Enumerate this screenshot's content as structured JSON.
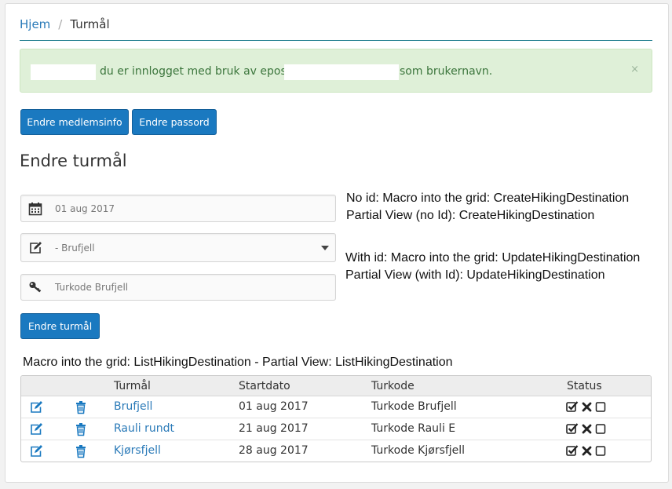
{
  "breadcrumb": {
    "home": "Hjem",
    "separator": "/",
    "current": "Turmål"
  },
  "alert": {
    "text_before": "du er innlogget med bruk av epost",
    "text_after": "som brukernavn.",
    "close": "×"
  },
  "buttons": {
    "member_info": "Endre medlemsinfo",
    "password": "Endre passord",
    "submit": "Endre turmål"
  },
  "form": {
    "title": "Endre turmål",
    "date_value": "01 aug 2017",
    "select_value": "- Brufjell",
    "code_value": "Turkode Brufjell",
    "icons": {
      "date": "calendar-icon",
      "select": "edit-icon",
      "code": "key-icon"
    }
  },
  "notes": {
    "line1": "No id: Macro into the grid: CreateHikingDestination",
    "line2": "Partial View (no Id): CreateHikingDestination",
    "line3": "With id: Macro into the grid: UpdateHikingDestination",
    "line4": "Partial View (with Id): UpdateHikingDestination",
    "table_caption": "Macro into the grid: ListHikingDestination - Partial View: ListHikingDestination"
  },
  "table": {
    "headers": {
      "destination": "Turmål",
      "start_date": "Startdato",
      "code": "Turkode",
      "status": "Status"
    },
    "rows": [
      {
        "name": "Brufjell",
        "date": "01 aug 2017",
        "code": "Turkode Brufjell"
      },
      {
        "name": "Rauli rundt",
        "date": "21 aug 2017",
        "code": "Turkode Rauli E"
      },
      {
        "name": "Kjørsfjell",
        "date": "28 aug 2017",
        "code": "Turkode Kjørsfjell"
      }
    ]
  },
  "colors": {
    "accent": "#1a79c0",
    "link": "#2a7ab8",
    "alert_bg": "#dff0d8",
    "alert_text": "#3c763d"
  }
}
